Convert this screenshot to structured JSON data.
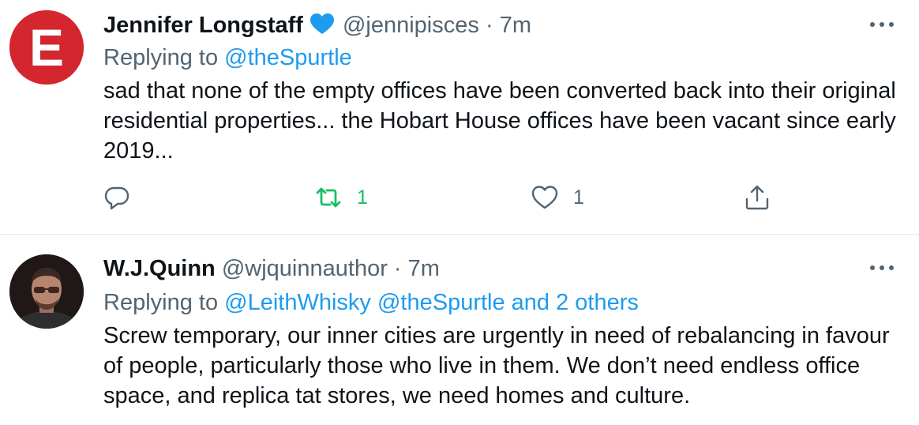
{
  "tweets": [
    {
      "name": "Jennifer Longstaff",
      "verified": true,
      "handle": "@jennipisces",
      "separator": "·",
      "time": "7m",
      "replying_prefix": "Replying to",
      "replying_to": "@theSpurtle",
      "avatar_letter": "E",
      "text": "sad that none of the empty offices have been converted back into their original residential properties... the Hobart House offices have been vacant since early 2019...",
      "actions": {
        "replies": "",
        "retweets": "1",
        "likes": "1"
      }
    },
    {
      "name": "W.J.Quinn",
      "handle": "@wjquinnauthor",
      "separator": "·",
      "time": "7m",
      "replying_prefix": "Replying to",
      "replying_to": "@LeithWhisky @theSpurtle and 2 others",
      "text": "Screw temporary, our inner cities are urgently in need of rebalancing in favour of people, particularly those who live in them. We don’t need endless office space, and replica tat stores, we need homes and culture."
    }
  ],
  "colors": {
    "accent": "#1d9bf0",
    "retweet": "#17bf63",
    "muted": "#536471",
    "avatar_red": "#d3262f",
    "divider": "#e1e8ed"
  },
  "icons": [
    "verified-badge-icon",
    "more-options-icon",
    "reply-icon",
    "retweet-icon",
    "like-icon",
    "share-icon"
  ]
}
